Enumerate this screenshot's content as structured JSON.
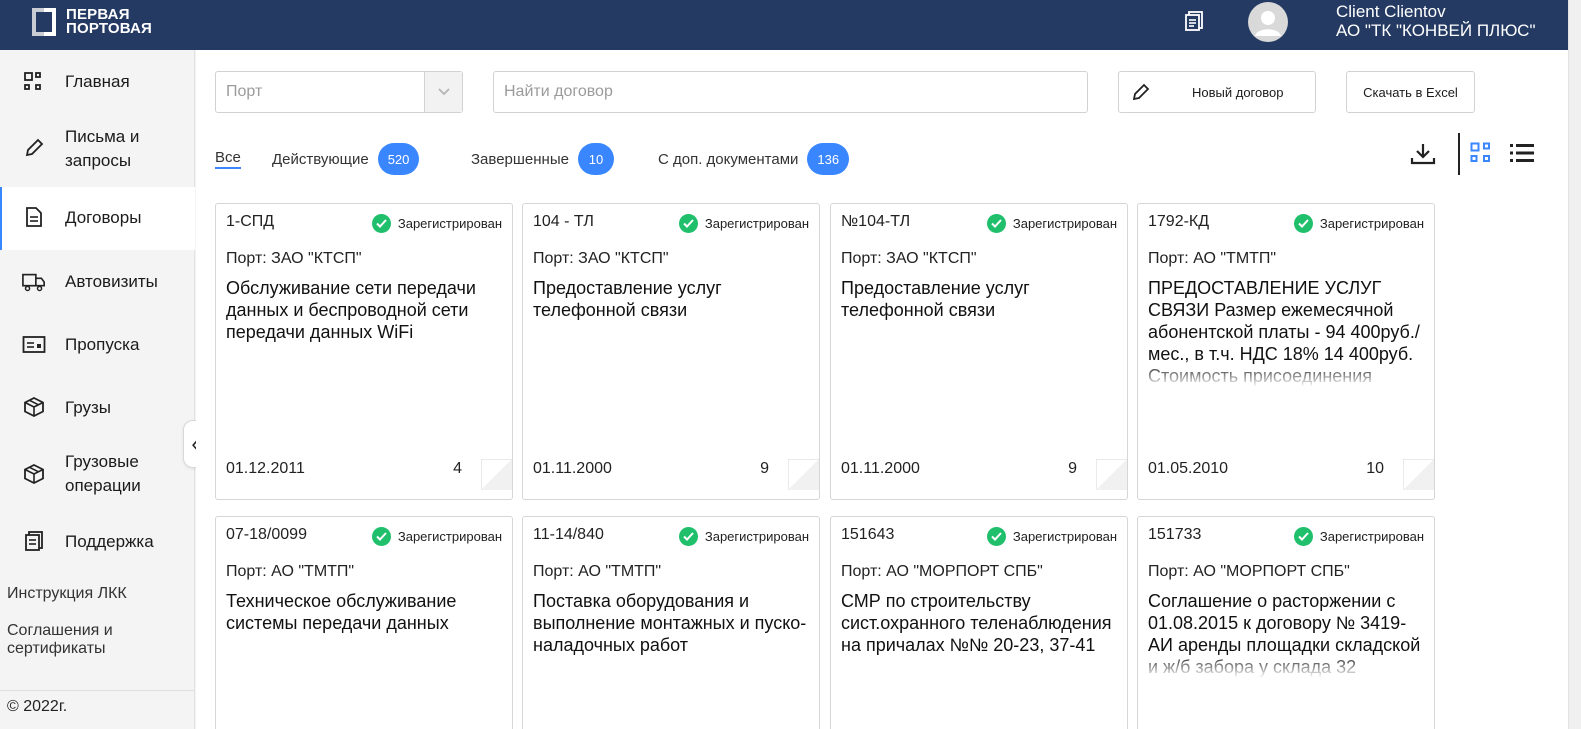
{
  "colors": {
    "header_bg": "#243a63",
    "accent": "#3a86ff",
    "status_ok": "#1fbf6c"
  },
  "brand": {
    "line1": "ПЕРВАЯ",
    "line2": "ПОРТОВАЯ"
  },
  "user": {
    "name": "Client Clientov",
    "company": "АО \"ТК \"КОНВЕЙ ПЛЮС\""
  },
  "sidebar": {
    "items": [
      {
        "label": "Главная",
        "icon": "grid-icon"
      },
      {
        "label": "Письма и",
        "label2": "запросы",
        "icon": "pencil-icon"
      },
      {
        "label": "Договоры",
        "icon": "document-icon",
        "active": true
      },
      {
        "label": "Автовизиты",
        "icon": "truck-icon"
      },
      {
        "label": "Пропуска",
        "icon": "pass-card-icon"
      },
      {
        "label": "Грузы",
        "icon": "box-icon"
      },
      {
        "label": "Грузовые",
        "label2": "операции",
        "icon": "cargo-box-icon"
      },
      {
        "label": "Поддержка",
        "icon": "support-doc-icon"
      }
    ],
    "links": {
      "instruction": "Инструкция ЛКК",
      "agreements1": "Соглашения и",
      "agreements2": "сертификаты"
    },
    "copyright": "© 2022г."
  },
  "toolbar": {
    "port_placeholder": "Порт",
    "search_placeholder": "Найти договор",
    "new_contract": "Новый договор",
    "excel": "Скачать в Excel"
  },
  "tabs": [
    {
      "label": "Все",
      "active": true
    },
    {
      "label": "Действующие",
      "count": "520"
    },
    {
      "label": "Завершенные",
      "count": "10"
    },
    {
      "label": "С доп. документами",
      "count": "136"
    }
  ],
  "cards": [
    {
      "number": "1-СПД",
      "status": "Зарегистрирован",
      "port": "Порт: ЗАО \"КТСП\"",
      "description": "Обслуживание сети передачи данных и беспроводной сети передачи данных WiFi",
      "date": "01.12.2011",
      "count": "4"
    },
    {
      "number": "104 - ТЛ",
      "status": "Зарегистрирован",
      "port": "Порт: ЗАО \"КТСП\"",
      "description": "Предоставление услуг телефонной связи",
      "date": "01.11.2000",
      "count": "9"
    },
    {
      "number": "№104-ТЛ",
      "status": "Зарегистрирован",
      "port": "Порт: ЗАО \"КТСП\"",
      "description": "Предоставление услуг телефонной связи",
      "date": "01.11.2000",
      "count": "9"
    },
    {
      "number": "1792-КД",
      "status": "Зарегистрирован",
      "port": "Порт: АО \"ТМТП\"",
      "description": "ПРЕДОСТАВЛЕНИЕ УСЛУГ СВЯЗИ Размер ежемесячной абонентской платы - 94 400руб./мес., в т.ч. НДС 18% 14 400руб. Стоимость присоединения",
      "date": "01.05.2010",
      "count": "10"
    },
    {
      "number": "07-18/0099",
      "status": "Зарегистрирован",
      "port": "Порт: АО \"ТМТП\"",
      "description": "Техническое обслуживание системы передачи данных",
      "date": "",
      "count": ""
    },
    {
      "number": "11-14/840",
      "status": "Зарегистрирован",
      "port": "Порт: АО \"ТМТП\"",
      "description": "Поставка оборудования и выполнение монтажных и пуско-наладочных работ",
      "date": "",
      "count": ""
    },
    {
      "number": "151643",
      "status": "Зарегистрирован",
      "port": "Порт: АО \"МОРПОРТ СПБ\"",
      "description": "СМР по строительству сист.охранного теленаблюдения на причалах №№ 20-23, 37-41",
      "date": "",
      "count": ""
    },
    {
      "number": "151733",
      "status": "Зарегистрирован",
      "port": "Порт: АО \"МОРПОРТ СПБ\"",
      "description": "Соглашение о расторжении с 01.08.2015 к договору № 3419-АИ аренды площадки складской и ж/б забора у склада 32",
      "date": "",
      "count": ""
    }
  ]
}
